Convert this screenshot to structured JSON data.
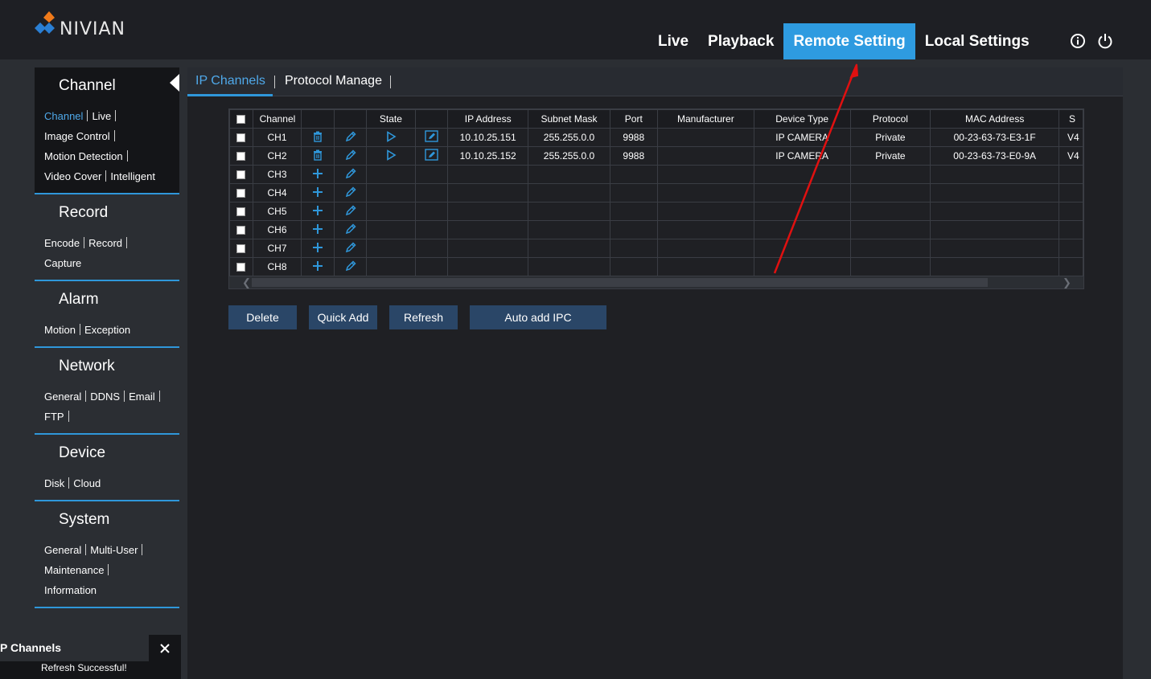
{
  "brand": {
    "name": "NIVIAN"
  },
  "nav": {
    "items": [
      "Live",
      "Playback",
      "Remote Setting",
      "Local Settings"
    ],
    "active": "Remote Setting",
    "icons": [
      "info-icon",
      "power-icon"
    ]
  },
  "sidebar": {
    "channel": {
      "title": "Channel",
      "items": [
        "Channel",
        "Live",
        "Image Control",
        "Motion Detection",
        "Video Cover",
        "Intelligent"
      ],
      "active": "Channel"
    },
    "record": {
      "title": "Record",
      "items": [
        "Encode",
        "Record",
        "Capture"
      ]
    },
    "alarm": {
      "title": "Alarm",
      "items": [
        "Motion",
        "Exception"
      ]
    },
    "network": {
      "title": "Network",
      "items": [
        "General",
        "DDNS",
        "Email",
        "FTP"
      ]
    },
    "device": {
      "title": "Device",
      "items": [
        "Disk",
        "Cloud"
      ]
    },
    "system": {
      "title": "System",
      "items": [
        "General",
        "Multi-User",
        "Maintenance",
        "Information"
      ]
    }
  },
  "tabs": {
    "items": [
      "IP Channels",
      "Protocol Manage"
    ],
    "active": "IP Channels"
  },
  "table": {
    "headers": [
      "",
      "Channel",
      "",
      "",
      "State",
      "",
      "IP Address",
      "Subnet Mask",
      "Port",
      "Manufacturer",
      "Device Type",
      "Protocol",
      "MAC Address",
      "S"
    ],
    "rows": [
      {
        "channel": "CH1",
        "configured": true,
        "ip": "10.10.25.151",
        "mask": "255.255.0.0",
        "port": "9988",
        "manufacturer": "",
        "device_type": "IP CAMERA",
        "protocol": "Private",
        "mac": "00-23-63-73-E3-1F",
        "extra": "V4"
      },
      {
        "channel": "CH2",
        "configured": true,
        "ip": "10.10.25.152",
        "mask": "255.255.0.0",
        "port": "9988",
        "manufacturer": "",
        "device_type": "IP CAMERA",
        "protocol": "Private",
        "mac": "00-23-63-73-E0-9A",
        "extra": "V4"
      },
      {
        "channel": "CH3",
        "configured": false
      },
      {
        "channel": "CH4",
        "configured": false
      },
      {
        "channel": "CH5",
        "configured": false
      },
      {
        "channel": "CH6",
        "configured": false
      },
      {
        "channel": "CH7",
        "configured": false
      },
      {
        "channel": "CH8",
        "configured": false
      }
    ]
  },
  "buttons": {
    "delete": "Delete",
    "quick_add": "Quick Add",
    "refresh": "Refresh",
    "auto_add": "Auto add IPC"
  },
  "toast": {
    "title": "P Channels",
    "message": "Refresh Successful!"
  },
  "colors": {
    "accent": "#2e9be0",
    "button": "#2a4667",
    "annotation": "#e01010"
  }
}
